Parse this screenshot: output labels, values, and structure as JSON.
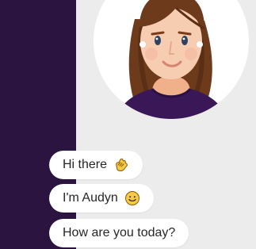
{
  "conversation": {
    "messages": [
      {
        "text": "Hi there",
        "icon": "waving-hand-icon"
      },
      {
        "text": "I'm Audyn",
        "icon": "smiling-face-icon"
      },
      {
        "text": "How are you today?"
      }
    ]
  },
  "colors": {
    "sidebar": "#2c1440",
    "chat_background": "#ececec",
    "bubble_background": "#ffffff",
    "bubble_text": "#262626",
    "avatar_hair": "#6e3a1c",
    "avatar_skin": "#f7cdb2",
    "avatar_shirt": "#3a1857"
  },
  "avatar": {
    "icon": "assistant-avatar"
  }
}
